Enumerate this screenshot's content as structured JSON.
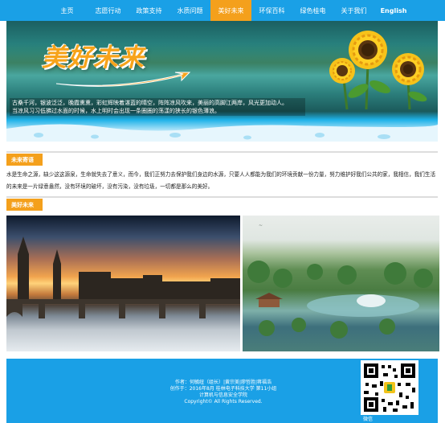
{
  "nav": {
    "items": [
      "主页",
      "志愿行动",
      "政策支持",
      "水质问题",
      "美好未来",
      "环保百科",
      "绿色桂电",
      "关于我们",
      "English"
    ]
  },
  "banner": {
    "title": "美好未来",
    "caption_line1": "古桑千河，银波泛泛，晚霞熏熏，彩虹辉映着湛蓝的晴空，阵阵凉风吹来，美丽的高脚江两岸，风光更加动人。",
    "caption_line2": "当凉风习习低拂过水面的时候，水上明时会出现一条圈圈的荡漾的狭长的银色薄浪。"
  },
  "section1": {
    "label": "未来寄语",
    "text": "水是生命之源，缺少这这源泉，生命就失去了意义，而今，我们正努力去保护我们身边的水源，只要人人都能为我们的环境贡献一份力量，努力维护好我们公共的家，我相信，我们生活的未来是一片绿意盎然，没有环境的破坏，没有污染，没有垃圾，一切都是那么的美好。"
  },
  "section2": {
    "label": "美好未来"
  },
  "footer": {
    "line1": "作者：何毓纽（组长）|黄宗美|廖哲胜|蒋福浩",
    "line2": "创作于：2016年8月  桂林电子科技大学 第11小组",
    "line3": "计算机与信息安全学院",
    "line4": "Copyright© All Rights Reserved.",
    "wechat": "微信"
  },
  "colors": {
    "nav_bg": "#1aa0e6",
    "accent": "#f4a01c"
  }
}
